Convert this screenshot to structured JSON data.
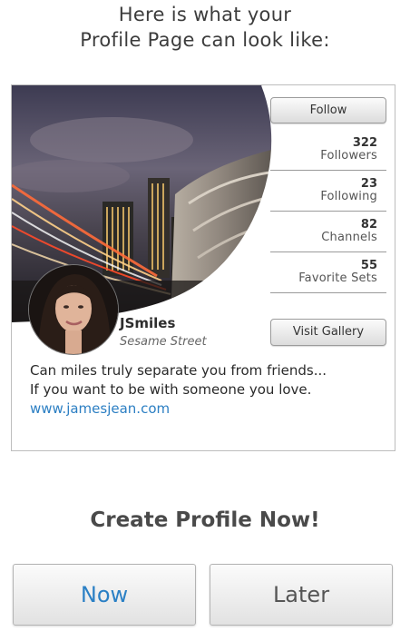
{
  "header": {
    "line1": "Here is what your",
    "line2": "Profile Page can look like:"
  },
  "profile": {
    "follow_label": "Follow",
    "stats": [
      {
        "value": "322",
        "label": "Followers"
      },
      {
        "value": "23",
        "label": "Following"
      },
      {
        "value": "82",
        "label": "Channels"
      },
      {
        "value": "55",
        "label": "Favorite Sets"
      }
    ],
    "visit_gallery_label": "Visit Gallery",
    "username": "JSmiles",
    "location": "Sesame Street",
    "bio_line1": "Can miles truly separate you from friends...",
    "bio_line2": "If you want to be with someone you love.",
    "website": "www.jamesjean.com"
  },
  "cta": {
    "title": "Create Profile Now!",
    "now_label": "Now",
    "later_label": "Later"
  },
  "colors": {
    "accent": "#2b80c5",
    "text": "#3a3a3a",
    "border": "#bdbdbd"
  }
}
